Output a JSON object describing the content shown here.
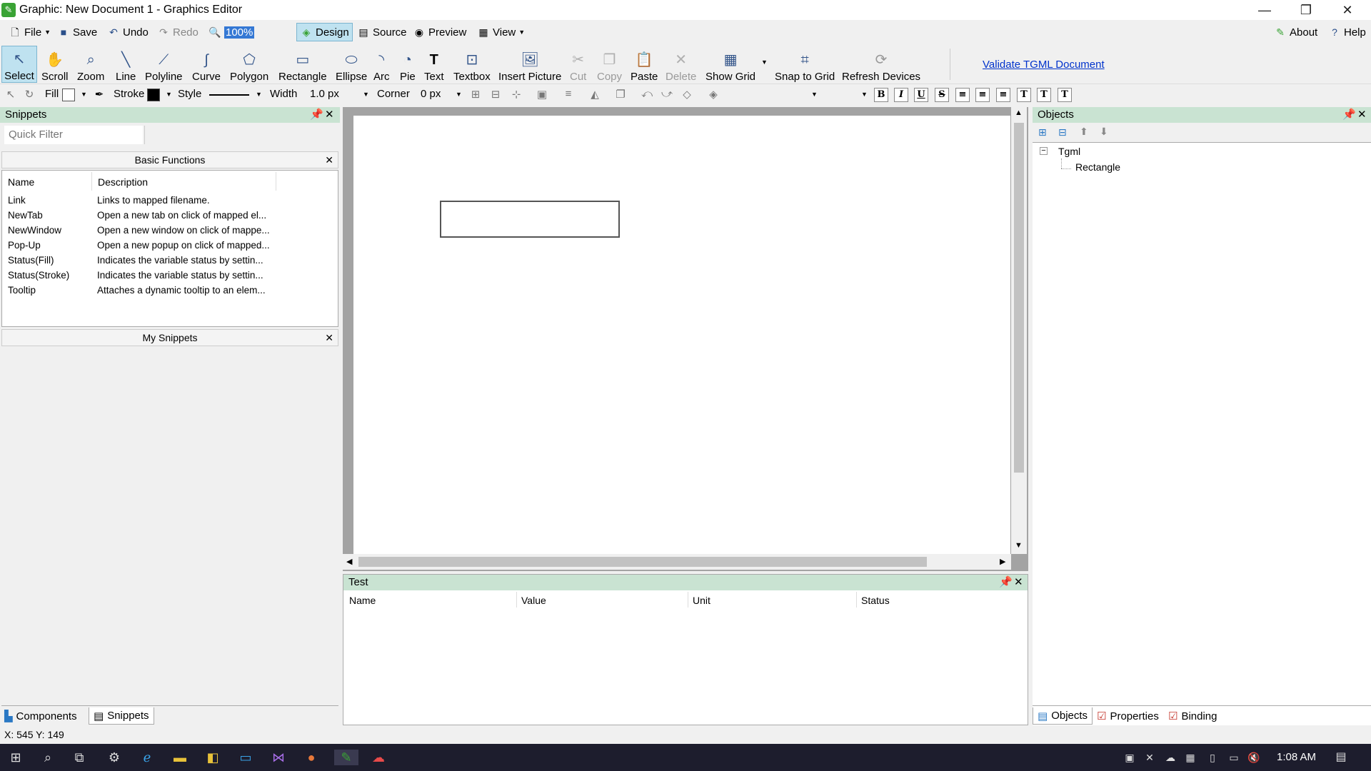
{
  "window": {
    "title": "Graphic: New Document 1 - Graphics Editor"
  },
  "menubar": {
    "file": "File",
    "save": "Save",
    "undo": "Undo",
    "redo": "Redo",
    "zoom_value": "100%",
    "design": "Design",
    "source": "Source",
    "preview": "Preview",
    "view": "View",
    "about": "About",
    "help": "Help"
  },
  "toolbar": {
    "tools": [
      {
        "label": "Select",
        "icon": "cursor-icon"
      },
      {
        "label": "Scroll",
        "icon": "hand-icon"
      },
      {
        "label": "Zoom",
        "icon": "magnifier-icon"
      },
      {
        "label": "Line",
        "icon": "line-icon"
      },
      {
        "label": "Polyline",
        "icon": "polyline-icon"
      },
      {
        "label": "Curve",
        "icon": "curve-icon"
      },
      {
        "label": "Polygon",
        "icon": "polygon-icon"
      },
      {
        "label": "Rectangle",
        "icon": "rectangle-icon"
      },
      {
        "label": "Ellipse",
        "icon": "ellipse-icon"
      },
      {
        "label": "Arc",
        "icon": "arc-icon"
      },
      {
        "label": "Pie",
        "icon": "pie-icon"
      },
      {
        "label": "Text",
        "icon": "text-icon"
      },
      {
        "label": "Textbox",
        "icon": "textbox-icon"
      },
      {
        "label": "Insert Picture",
        "icon": "picture-icon"
      },
      {
        "label": "Cut",
        "icon": "scissors-icon"
      },
      {
        "label": "Copy",
        "icon": "copy-icon"
      },
      {
        "label": "Paste",
        "icon": "paste-icon"
      },
      {
        "label": "Delete",
        "icon": "delete-icon"
      },
      {
        "label": "Show Grid",
        "icon": "grid-icon"
      },
      {
        "label": "Snap to Grid",
        "icon": "snap-icon"
      },
      {
        "label": "Refresh Devices",
        "icon": "refresh-icon"
      }
    ],
    "validate_link": "Validate TGML Document"
  },
  "formatbar": {
    "fill_label": "Fill",
    "stroke_label": "Stroke",
    "style_label": "Style",
    "width_label": "Width",
    "width_value": "1.0 px",
    "corner_label": "Corner",
    "corner_value": "0 px",
    "stroke_color": "#000000",
    "fill_color": "#ffffff"
  },
  "snippets": {
    "title": "Snippets",
    "filter_placeholder": "Quick Filter",
    "basic_functions": "Basic Functions",
    "col_name": "Name",
    "col_desc": "Description",
    "rows": [
      {
        "name": "Link",
        "desc": "Links to mapped filename."
      },
      {
        "name": "NewTab",
        "desc": "Open a new tab on click of mapped el..."
      },
      {
        "name": "NewWindow",
        "desc": "Open a new window on click of mappe..."
      },
      {
        "name": "Pop-Up",
        "desc": "Open a new popup on click of mapped..."
      },
      {
        "name": "Status(Fill)",
        "desc": "Indicates the variable status by settin..."
      },
      {
        "name": "Status(Stroke)",
        "desc": "Indicates the variable status by settin..."
      },
      {
        "name": "Tooltip",
        "desc": "Attaches a dynamic tooltip to an elem..."
      }
    ],
    "my_snippets": "My Snippets"
  },
  "left_tabs": {
    "components": "Components",
    "snippets": "Snippets"
  },
  "test_panel": {
    "title": "Test",
    "cols": [
      "Name",
      "Value",
      "Unit",
      "Status"
    ]
  },
  "objects_panel": {
    "title": "Objects",
    "root": "Tgml",
    "child": "Rectangle"
  },
  "right_tabs": {
    "objects": "Objects",
    "properties": "Properties",
    "binding": "Binding"
  },
  "statusbar": {
    "coords": "X: 545  Y: 149"
  },
  "taskbar": {
    "time": "1:08 AM"
  }
}
